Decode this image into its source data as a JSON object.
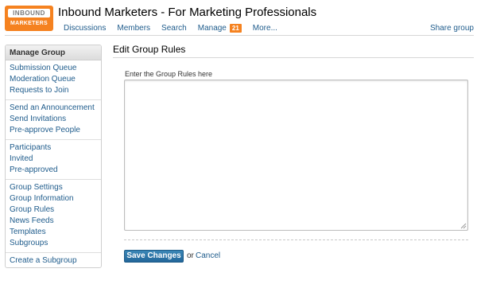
{
  "logo": {
    "top_text": "INBOUND",
    "bottom_text": "MARKETERS"
  },
  "group_title": "Inbound Marketers - For Marketing Professionals",
  "nav": {
    "items": [
      {
        "label": "Discussions"
      },
      {
        "label": "Members"
      },
      {
        "label": "Search"
      },
      {
        "label": "Manage",
        "badge": "21"
      },
      {
        "label": "More..."
      }
    ],
    "share": "Share group"
  },
  "sidebar": {
    "title": "Manage Group",
    "groups": [
      [
        "Submission Queue",
        "Moderation Queue",
        "Requests to Join"
      ],
      [
        "Send an Announcement",
        "Send Invitations",
        "Pre-approve People"
      ],
      [
        "Participants",
        "Invited",
        "Pre-approved"
      ],
      [
        "Group Settings",
        "Group Information",
        "Group Rules",
        "News Feeds",
        "Templates",
        "Subgroups"
      ],
      [
        "Create a Subgroup"
      ]
    ]
  },
  "main": {
    "title": "Edit Group Rules",
    "field_label": "Enter the Group Rules here",
    "textarea_value": "",
    "save_label": "Save Changes",
    "or_text": "or",
    "cancel_label": "Cancel"
  },
  "colors": {
    "accent": "#f58220",
    "link": "#1f5c8c",
    "button": "#2a73a8"
  }
}
